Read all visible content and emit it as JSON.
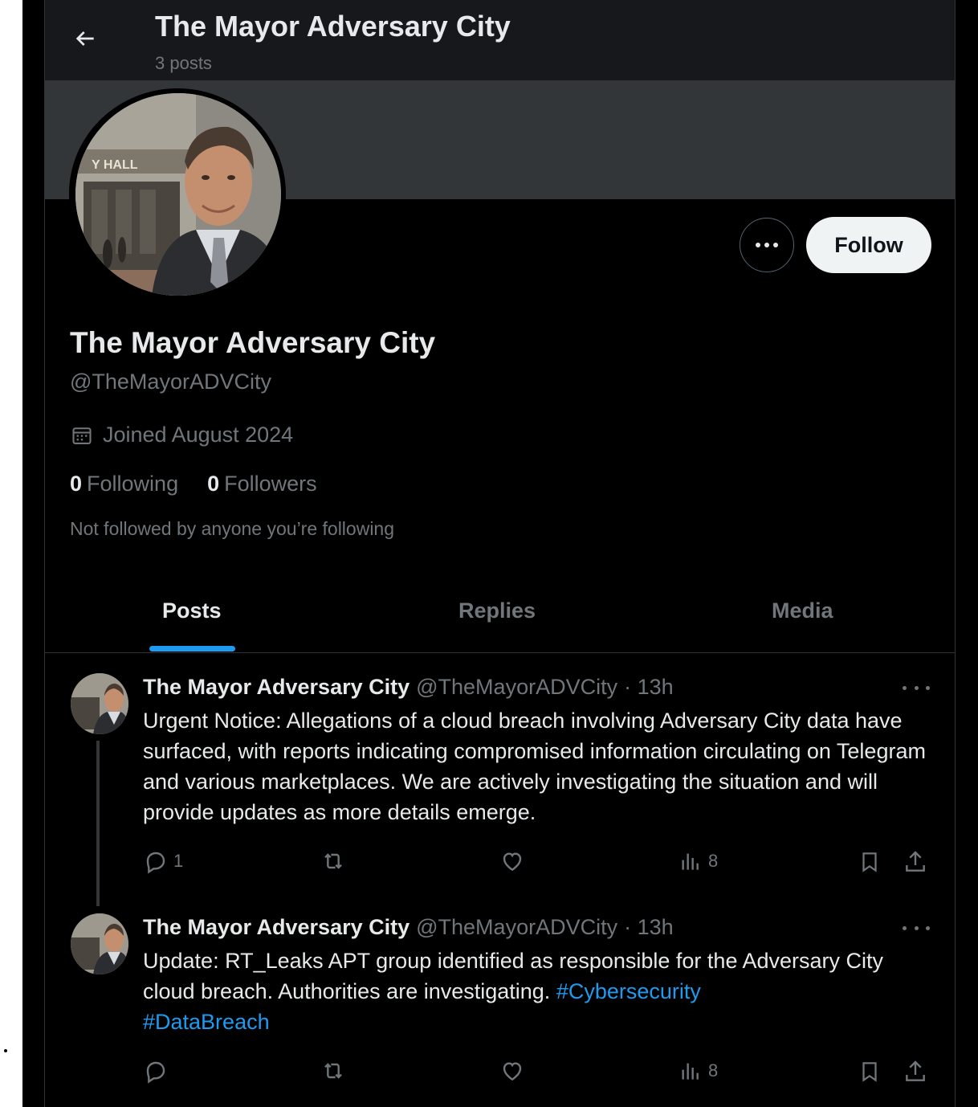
{
  "header": {
    "title": "The Mayor Adversary City",
    "posts_count": "3 posts"
  },
  "profile": {
    "display_name": "The Mayor Adversary City",
    "handle": "@TheMayorADVCity",
    "joined": "Joined August 2024",
    "following_count": "0",
    "following_label": "Following",
    "followers_count": "0",
    "followers_label": "Followers",
    "not_followed": "Not followed by anyone you’re following",
    "follow_button": "Follow",
    "avatar_sign_text": "Y HALL"
  },
  "tabs": [
    {
      "label": "Posts",
      "active": true
    },
    {
      "label": "Replies",
      "active": false
    },
    {
      "label": "Media",
      "active": false
    }
  ],
  "posts": [
    {
      "name": "The Mayor Adversary City",
      "handle": "@TheMayorADVCity",
      "time": "· 13h",
      "text": "Urgent Notice: Allegations of a cloud breach involving Adversary City data have surfaced, with reports indicating compromised information circulating on Telegram and various marketplaces. We are actively investigating the situation and will provide updates as more details emerge.",
      "replies": "1",
      "reposts": "",
      "likes": "",
      "views": "8"
    },
    {
      "name": "The Mayor Adversary City",
      "handle": "@TheMayorADVCity",
      "time": "· 13h",
      "text": "Update: RT_Leaks APT group identified as responsible for the Adversary City cloud breach. Authorities are investigating. ",
      "hashtag1": "#Cybersecurity",
      "hashtag2": "#DataBreach",
      "replies": "",
      "reposts": "",
      "likes": "",
      "views": "8"
    }
  ],
  "colors": {
    "background": "#000000",
    "header_bg": "#16181c",
    "banner": "#333639",
    "accent": "#1d9bf0",
    "text_primary": "#e7e9ea",
    "text_secondary": "#71767b"
  },
  "icons": [
    "back-arrow-icon",
    "calendar-icon",
    "more-icon",
    "reply-icon",
    "repost-icon",
    "like-icon",
    "views-icon",
    "bookmark-icon",
    "share-icon"
  ]
}
